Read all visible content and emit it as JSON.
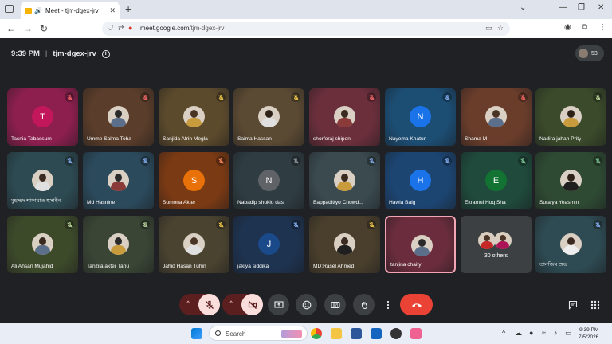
{
  "browser": {
    "tab_title": "Meet - tjm-dgex-jrv",
    "url_host": "meet.google.com",
    "url_path": "/tjm-dgex-jrv",
    "new_tab_label": "+"
  },
  "meeting": {
    "time": "9:39 PM",
    "separator": "|",
    "code": "tjm-dgex-jrv",
    "participant_count": "53"
  },
  "tiles": [
    {
      "name": "Tasnia Tabassum",
      "initial": "T",
      "bg": "#8c1f4e",
      "av": "#c2185b",
      "mic": "#ff6b6b"
    },
    {
      "name": "Umme Salma Toha",
      "initial": "",
      "bg": "#5a3d2a",
      "av": "photo",
      "mic": "#ff6b6b"
    },
    {
      "name": "Sanjida Afrin Megla",
      "initial": "",
      "bg": "#5c4a2c",
      "av": "photo",
      "mic": "#ffd54f"
    },
    {
      "name": "Saima Hassan",
      "initial": "",
      "bg": "#5b4a33",
      "av": "photo",
      "mic": "#ffd54f"
    },
    {
      "name": "shorforaj shipon",
      "initial": "",
      "bg": "#6b2f3c",
      "av": "photo",
      "mic": "#ff6b6b"
    },
    {
      "name": "Nayema Khatun",
      "initial": "N",
      "bg": "#1c4d73",
      "av": "#1a73e8",
      "mic": "#8ab4f8"
    },
    {
      "name": "Shama M",
      "initial": "",
      "bg": "#6a3d2b",
      "av": "photo",
      "mic": "#ff6b6b"
    },
    {
      "name": "Nadira jahan Prity",
      "initial": "",
      "bg": "#3a4a2a",
      "av": "photo",
      "mic": "#c5e1a5"
    },
    {
      "name": "মুহাম্মদ শাফায়াত হুসাইন",
      "initial": "",
      "bg": "#2d4a52",
      "av": "photo",
      "mic": "#8ab4f8"
    },
    {
      "name": "Md Hasnine",
      "initial": "",
      "bg": "#2b4a5c",
      "av": "photo",
      "mic": "#8ab4f8"
    },
    {
      "name": "Sumona Akter",
      "initial": "S",
      "bg": "#7a3a14",
      "av": "#e8710a",
      "mic": "#ff8a65"
    },
    {
      "name": "Nabadip shuklo das",
      "initial": "N",
      "bg": "#2f3d42",
      "av": "#5f6368",
      "mic": "#9aa0a6"
    },
    {
      "name": "Bappadittyo Chowd...",
      "initial": "",
      "bg": "#3a4a4f",
      "av": "photo",
      "mic": "#8ab4f8"
    },
    {
      "name": "Hawla Baig",
      "initial": "H",
      "bg": "#1c4572",
      "av": "#1a73e8",
      "mic": "#8ab4f8"
    },
    {
      "name": "Ekramul Hoq Sha",
      "initial": "E",
      "bg": "#1f4a3c",
      "av": "#137333",
      "mic": "#81c995"
    },
    {
      "name": "Suraiya Yeasmin",
      "initial": "",
      "bg": "#2e4a33",
      "av": "photo",
      "mic": "#81c995"
    },
    {
      "name": "Ali Ahsan Mujahid",
      "initial": "",
      "bg": "#3d4a2a",
      "av": "photo",
      "mic": "#c5e1a5"
    },
    {
      "name": "Tanzila akter Tanu",
      "initial": "",
      "bg": "#3a4535",
      "av": "photo",
      "mic": "#c5e1a5"
    },
    {
      "name": "Jahid Hasan Tuhin",
      "initial": "",
      "bg": "#4a4330",
      "av": "photo",
      "mic": "#ffd54f"
    },
    {
      "name": "jakiya siddika",
      "initial": "J",
      "bg": "#1e3350",
      "av": "#1a4a8a",
      "mic": "#8ab4f8"
    },
    {
      "name": "MD:Rasel Ahmed",
      "initial": "",
      "bg": "#4a3f2c",
      "av": "photo",
      "mic": "#ffd54f"
    },
    {
      "name": "tanjina chaity",
      "initial": "",
      "bg": "#6b2d3d",
      "av": "photo",
      "mic": ""
    }
  ],
  "others_tile": {
    "label": "30 others"
  },
  "last_tile": {
    "name": "তানজিম শুভ",
    "bg": "#2e4a52",
    "mic": "#8ab4f8"
  },
  "controls": {
    "mic_state": "muted",
    "camera_state": "off",
    "icons": [
      "present-icon",
      "emoji-icon",
      "captions-icon",
      "raise-hand-icon",
      "more-options-icon",
      "leave-call-icon"
    ],
    "side_icons": [
      "chat-icon",
      "activities-icon"
    ]
  },
  "taskbar": {
    "search_placeholder": "Search",
    "time": "9:39 PM",
    "date": "7/5/2026"
  },
  "colors": {
    "meet_bg": "#202124",
    "hangup": "#ea4335",
    "muted_toggle": "#f9dedc"
  }
}
